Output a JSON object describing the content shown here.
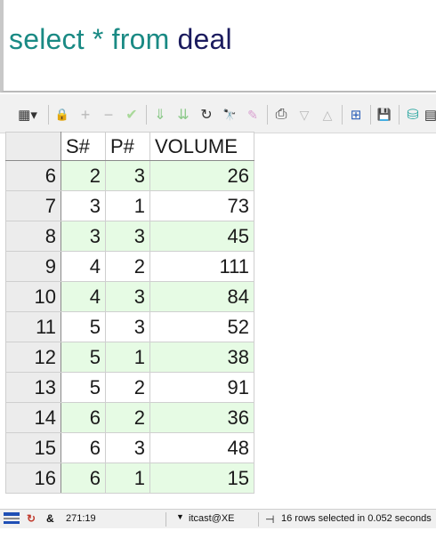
{
  "editor": {
    "kw_select": "select",
    "star": "*",
    "kw_from": "from",
    "table": "deal"
  },
  "toolbar": {
    "grid_menu_icon": "▦▾",
    "lock_icon": "🔒",
    "add_icon": "+",
    "remove_icon": "−",
    "post_icon": "✔",
    "down_icon": "⇓",
    "last_icon": "⇊",
    "refresh_icon": "↻",
    "find_icon": "🔭",
    "clear_icon": "✎",
    "print_icon": "⎙",
    "next_icon": "▽",
    "prev_icon": "△",
    "tree_icon": "⊞",
    "save_icon": "💾",
    "db_icon": "⛁",
    "extra_icon": "▤"
  },
  "grid": {
    "columns": [
      "S#",
      "P#",
      "VOLUME"
    ],
    "rows": [
      {
        "n": "6",
        "s": "2",
        "p": "3",
        "v": "26"
      },
      {
        "n": "7",
        "s": "3",
        "p": "1",
        "v": "73"
      },
      {
        "n": "8",
        "s": "3",
        "p": "3",
        "v": "45"
      },
      {
        "n": "9",
        "s": "4",
        "p": "2",
        "v": "111"
      },
      {
        "n": "10",
        "s": "4",
        "p": "3",
        "v": "84"
      },
      {
        "n": "11",
        "s": "5",
        "p": "3",
        "v": "52"
      },
      {
        "n": "12",
        "s": "5",
        "p": "1",
        "v": "38"
      },
      {
        "n": "13",
        "s": "5",
        "p": "2",
        "v": "91"
      },
      {
        "n": "14",
        "s": "6",
        "p": "2",
        "v": "36"
      },
      {
        "n": "15",
        "s": "6",
        "p": "3",
        "v": "48"
      },
      {
        "n": "16",
        "s": "6",
        "p": "1",
        "v": "15"
      }
    ]
  },
  "status": {
    "position": "271:19",
    "connection": "itcast@XE",
    "message": "16 rows selected in 0.052 seconds"
  },
  "colors": {
    "alt_row": "#e6fbe4",
    "keyword": "#1a8a84",
    "identifier": "#1b1b5e"
  }
}
